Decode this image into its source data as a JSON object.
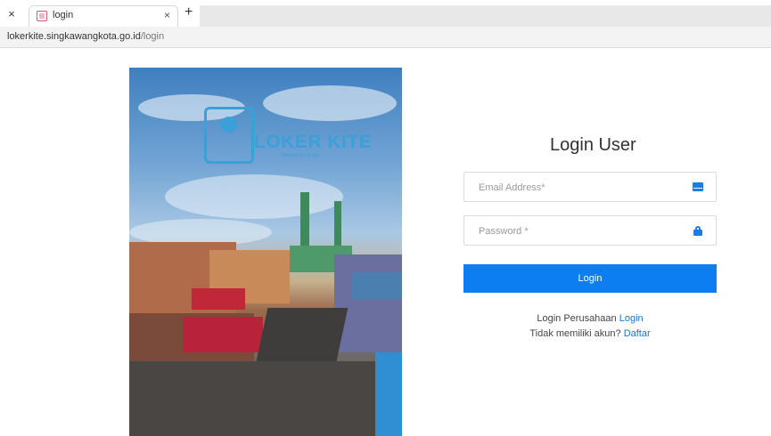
{
  "browser": {
    "close_glyph": "×",
    "tab": {
      "title": "login",
      "close_glyph": "×"
    },
    "new_tab_glyph": "+",
    "url_host": "lokerkite.singkawangkota.go.id",
    "url_path": "/login"
  },
  "hero": {
    "logo_text": "LOKER KITE",
    "logo_tagline": "Temukan Kerja Kita"
  },
  "login": {
    "title": "Login User",
    "email_placeholder": "Email Address*",
    "password_placeholder": "Password *",
    "button_label": "Login",
    "company_prefix": "Login Perusahaan",
    "company_link": "Login",
    "register_prefix": "Tidak memiliki akun?",
    "register_link": "Daftar"
  },
  "icons": {
    "email": "envelope-icon",
    "password": "lock-icon"
  },
  "colors": {
    "accent": "#0d7ef0",
    "link": "#1a76c9",
    "logo": "#3aa0d8"
  }
}
